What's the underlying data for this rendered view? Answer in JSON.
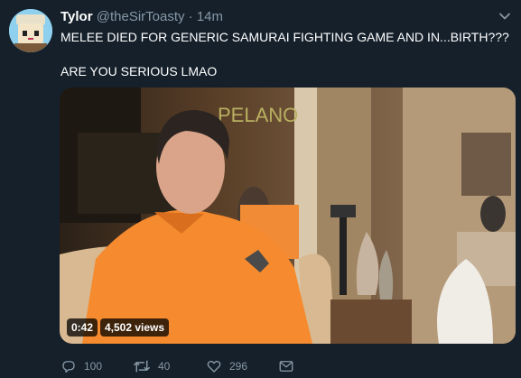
{
  "tweet": {
    "author_name": "Tylor",
    "handle": "@theSirToasty",
    "separator": "·",
    "time": "14m",
    "text_line1": "MELEE DIED FOR GENERIC SAMURAI FIGHTING GAME AND IN...BIRTH???",
    "text_line2": "ARE YOU SERIOUS LMAO"
  },
  "media": {
    "sign_text": "PELANO",
    "duration": "0:42",
    "views": "4,502 views"
  },
  "actions": {
    "reply_count": "100",
    "retweet_count": "40",
    "like_count": "296"
  },
  "icons": {
    "caret": "chevron-down-icon",
    "reply": "reply-icon",
    "retweet": "retweet-icon",
    "like": "heart-icon",
    "dm": "envelope-icon"
  },
  "colors": {
    "background": "#15202b",
    "secondary_text": "#8899a6",
    "shirt": "#f58a2e"
  }
}
